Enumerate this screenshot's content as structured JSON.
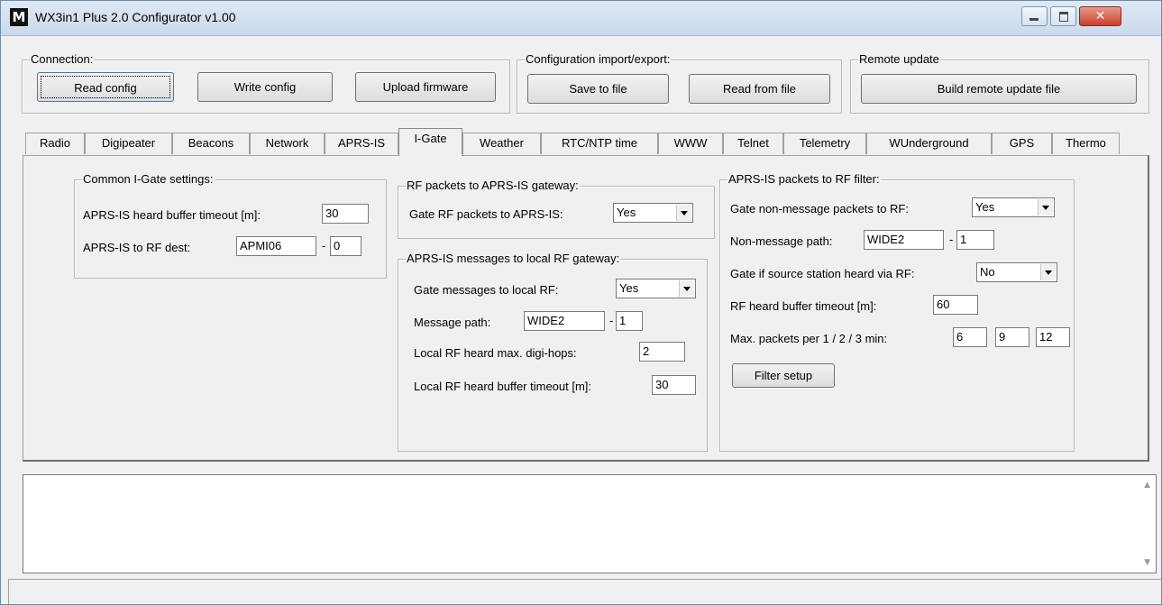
{
  "window": {
    "title": "WX3in1 Plus 2.0 Configurator v1.00",
    "icon": "M"
  },
  "connection": {
    "title": "Connection:",
    "read_config": "Read config",
    "write_config": "Write config",
    "upload_firmware": "Upload firmware"
  },
  "import_export": {
    "title": "Configuration import/export:",
    "save_to_file": "Save to file",
    "read_from_file": "Read from file"
  },
  "remote_update": {
    "title": "Remote update",
    "build": "Build remote update file"
  },
  "tabs": [
    "Radio",
    "Digipeater",
    "Beacons",
    "Network",
    "APRS-IS",
    "I-Gate",
    "Weather",
    "RTC/NTP time",
    "WWW",
    "Telnet",
    "Telemetry",
    "WUnderground",
    "GPS",
    "Thermo"
  ],
  "common": {
    "title": "Common I-Gate settings:",
    "heard_timeout_label": "APRS-IS heard buffer timeout [m]:",
    "heard_timeout_value": "30",
    "rf_dest_label": "APRS-IS to RF dest:",
    "rf_dest_call": "APMI06",
    "rf_dest_sep": "-",
    "rf_dest_ssid": "0"
  },
  "rf_to_aprs": {
    "title": "RF packets to APRS-IS gateway:",
    "gate_label": "Gate RF packets to APRS-IS:",
    "gate_value": "Yes"
  },
  "msg_to_rf": {
    "title": "APRS-IS messages to local RF gateway:",
    "gate_label": "Gate messages to local RF:",
    "gate_value": "Yes",
    "path_label": "Message path:",
    "path_call": "WIDE2",
    "path_sep": "-",
    "path_n": "1",
    "hops_label": "Local RF heard max. digi-hops:",
    "hops_value": "2",
    "timeout_label": "Local RF heard buffer timeout [m]:",
    "timeout_value": "30"
  },
  "aprs_to_rf": {
    "title": "APRS-IS packets to RF filter:",
    "nonmsg_label": "Gate non-message packets to RF:",
    "nonmsg_value": "Yes",
    "path_label": "Non-message path:",
    "path_call": "WIDE2",
    "path_sep": "-",
    "path_n": "1",
    "heard_label": "Gate if source station heard via RF:",
    "heard_value": "No",
    "timeout_label": "RF heard buffer timeout [m]:",
    "timeout_value": "60",
    "maxpk_label": "Max. packets per 1 / 2 / 3 min:",
    "maxpk_1": "6",
    "maxpk_2": "9",
    "maxpk_3": "12",
    "filter_setup": "Filter setup"
  }
}
